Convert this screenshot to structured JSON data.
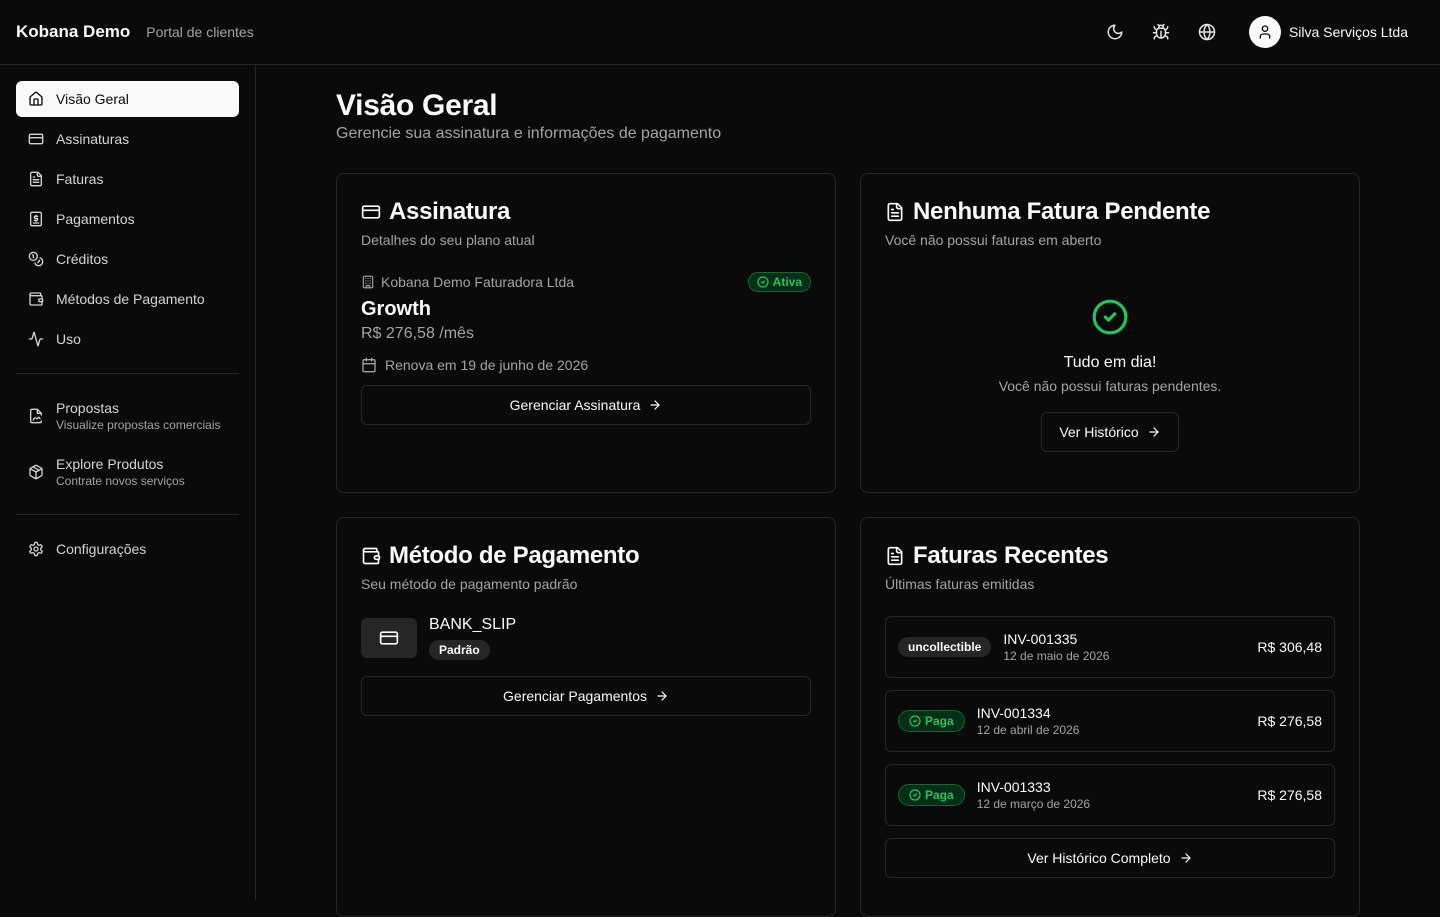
{
  "header": {
    "brand": "Kobana Demo",
    "subtitle": "Portal de clientes",
    "user_name": "Silva Serviços Ltda",
    "icons": [
      "moon-icon",
      "bug-icon",
      "globe-icon",
      "user-icon"
    ]
  },
  "sidebar": {
    "items": [
      {
        "label": "Visão Geral",
        "icon": "home-icon"
      },
      {
        "label": "Assinaturas",
        "icon": "credit-card-icon"
      },
      {
        "label": "Faturas",
        "icon": "file-text-icon"
      },
      {
        "label": "Pagamentos",
        "icon": "receipt-dollar-icon"
      },
      {
        "label": "Créditos",
        "icon": "coins-icon"
      },
      {
        "label": "Métodos de Pagamento",
        "icon": "wallet-icon"
      },
      {
        "label": "Uso",
        "icon": "activity-icon"
      }
    ],
    "extras": [
      {
        "label": "Propostas",
        "sub": "Visualize propostas comerciais",
        "icon": "file-signature-icon"
      },
      {
        "label": "Explore Produtos",
        "sub": "Contrate novos serviços",
        "icon": "package-icon"
      }
    ],
    "settings": {
      "label": "Configurações",
      "icon": "gear-icon"
    }
  },
  "main": {
    "title": "Visão Geral",
    "subtitle": "Gerencie sua assinatura e informações de pagamento"
  },
  "subscription": {
    "title": "Assinatura",
    "subtitle": "Detalhes do seu plano atual",
    "org": "Kobana Demo Faturadora Ltda",
    "status": "Ativa",
    "plan": "Growth",
    "price": "R$ 276,58 /mês",
    "renew": "Renova em 19 de junho de 2026",
    "button": "Gerenciar Assinatura"
  },
  "pending": {
    "title": "Nenhuma Fatura Pendente",
    "subtitle": "Você não possui faturas em aberto",
    "empty_title": "Tudo em dia!",
    "empty_sub": "Você não possui faturas pendentes.",
    "button": "Ver Histórico"
  },
  "payment_method": {
    "title": "Método de Pagamento",
    "subtitle": "Seu método de pagamento padrão",
    "name": "BANK_SLIP",
    "badge": "Padrão",
    "button": "Gerenciar Pagamentos"
  },
  "recent_invoices": {
    "title": "Faturas Recentes",
    "subtitle": "Últimas faturas emitidas",
    "rows": [
      {
        "status": "uncollectible",
        "id": "INV-001335",
        "date": "12 de maio de 2026",
        "amount": "R$ 306,48"
      },
      {
        "status": "Paga",
        "id": "INV-001334",
        "date": "12 de abril de 2026",
        "amount": "R$ 276,58"
      },
      {
        "status": "Paga",
        "id": "INV-001333",
        "date": "12 de março de 2026",
        "amount": "R$ 276,58"
      }
    ],
    "button": "Ver Histórico Completo"
  },
  "colors": {
    "background": "#0a0a0a",
    "border": "#262626",
    "success": "#22c55e",
    "muted_text": "#a3a3a3"
  }
}
